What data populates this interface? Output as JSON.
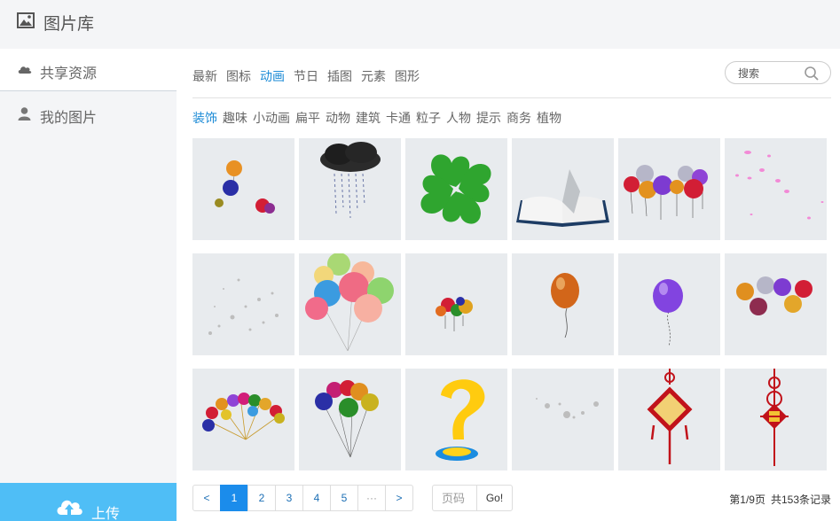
{
  "header": {
    "title": "图片库",
    "logo_icon": "image-icon"
  },
  "sidebar": {
    "items": [
      {
        "label": "共享资源",
        "icon": "cloud-icon",
        "active": true
      },
      {
        "label": "我的图片",
        "icon": "user-icon",
        "active": false
      }
    ],
    "upload": {
      "label": "上传",
      "icon": "cloud-upload-icon",
      "color": "#4fbef6"
    }
  },
  "categories": {
    "items": [
      "最新",
      "图标",
      "动画",
      "节日",
      "插图",
      "元素",
      "图形"
    ],
    "selected": "动画"
  },
  "search": {
    "placeholder": "搜索",
    "value": ""
  },
  "subcategories": {
    "items": [
      "装饰",
      "趣味",
      "小动画",
      "扁平",
      "动物",
      "建筑",
      "卡通",
      "粒子",
      "人物",
      "提示",
      "商务",
      "植物"
    ],
    "selected": "装饰"
  },
  "gallery": {
    "tiles": [
      "balloons-small",
      "rain-cloud",
      "four-leaf-clover",
      "open-book",
      "balloon-bunch",
      "pink-petals",
      "silver-sparkles",
      "pastel-balloons",
      "mini-balloons",
      "orange-balloon",
      "purple-balloon",
      "balloon-row",
      "balloon-fan",
      "balloon-bouquet",
      "yellow-question-mark",
      "grey-particles",
      "chinese-knot-lantern",
      "chinese-knot-red"
    ]
  },
  "pagination": {
    "prev": "<",
    "pages": [
      "1",
      "2",
      "3",
      "4",
      "5",
      "···"
    ],
    "current": "1",
    "next": ">",
    "goto_placeholder": "页码",
    "go_label": "Go!",
    "page_info": "第1/9页",
    "total_info": "共153条记录"
  },
  "colors": {
    "accent": "#1c8bd6",
    "active_page": "#1b8ceb",
    "tile_bg": "#e8ebee"
  }
}
